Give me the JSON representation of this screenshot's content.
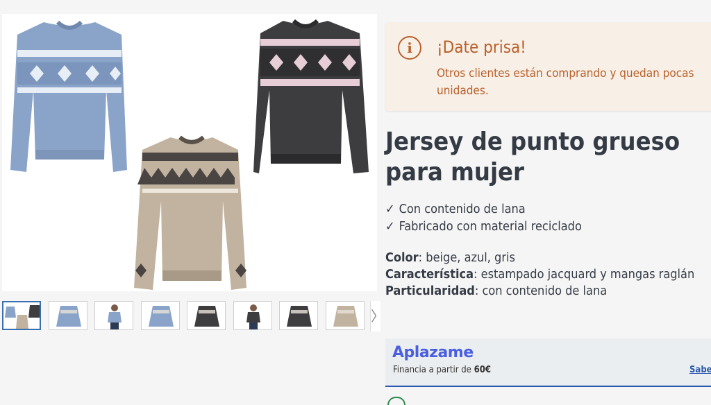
{
  "gallery": {
    "thumbnails": [
      {
        "name": "thumb-group",
        "active": true
      },
      {
        "name": "thumb-blue-sweater",
        "active": false
      },
      {
        "name": "thumb-model-blue",
        "active": false
      },
      {
        "name": "thumb-blue-sweater-2",
        "active": false
      },
      {
        "name": "thumb-dark-sweater",
        "active": false
      },
      {
        "name": "thumb-model-dark",
        "active": false
      },
      {
        "name": "thumb-dark-sweater-2",
        "active": false
      },
      {
        "name": "thumb-beige-sweater",
        "active": false
      }
    ],
    "next_glyph": "〉"
  },
  "alert": {
    "icon": "info-icon",
    "icon_glyph": "i",
    "title": "¡Date prisa!",
    "text": "Otros clientes están comprando y quedan pocas unidades."
  },
  "product": {
    "title": "Jersey de punto grueso para mujer",
    "features": [
      "Con contenido de lana",
      "Fabricado con material reciclado"
    ],
    "check_glyph": "✓",
    "specs": [
      {
        "label": "Color",
        "value": "beige, azul, gris"
      },
      {
        "label": "Característica",
        "value": "estampado jacquard y mangas raglán"
      },
      {
        "label": "Particularidad",
        "value": "con contenido de lana"
      }
    ]
  },
  "finance": {
    "brand": "Aplazame",
    "text_prefix": "Financia a partir de ",
    "amount": "60€",
    "link": "Saber"
  },
  "colors": {
    "alert_accent": "#b8612b",
    "alert_bg": "#f8efe6",
    "text_dark": "#353b45",
    "aplazame_blue": "#4a5fe0",
    "link_blue": "#2a5ab0",
    "sweater_blue": "#8aa3c8",
    "sweater_dark": "#3d3d3f",
    "sweater_beige": "#c2b3a0"
  }
}
